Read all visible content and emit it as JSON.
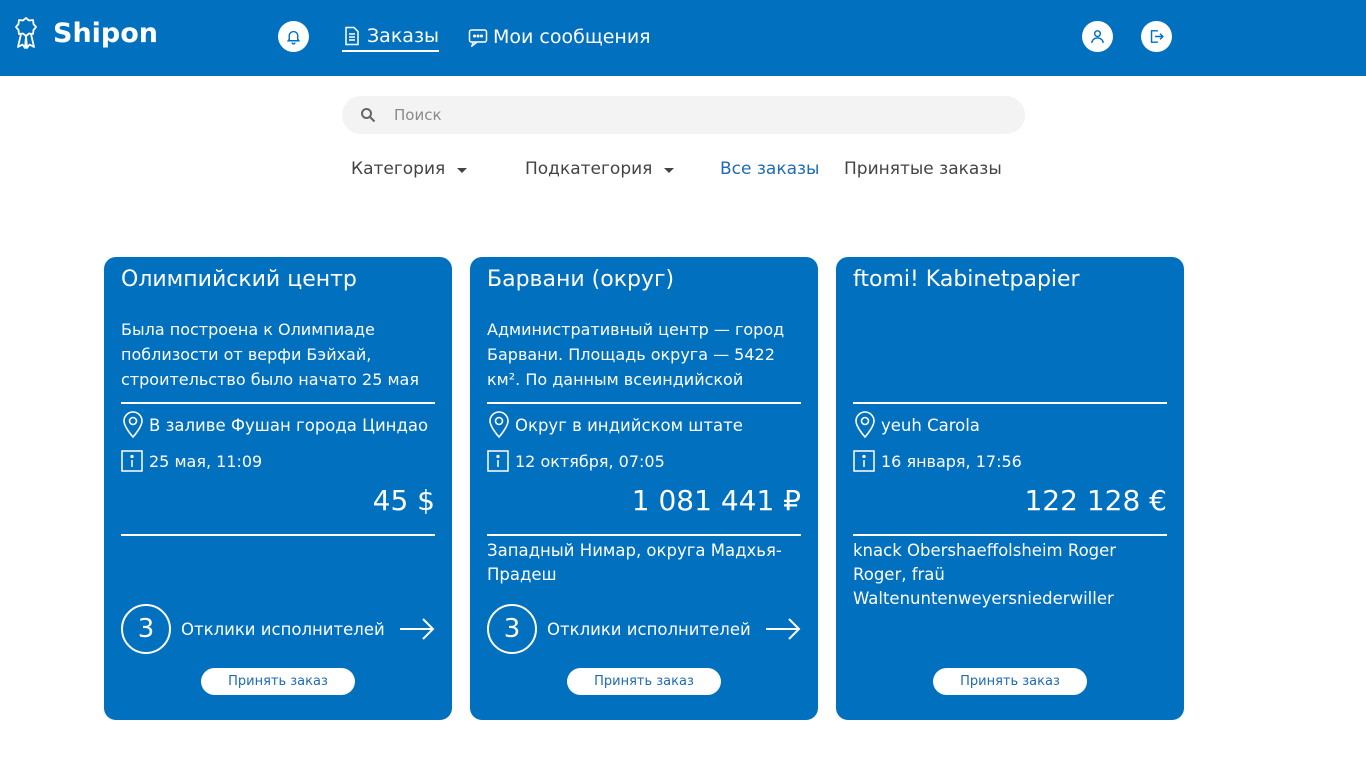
{
  "app": {
    "name": "Shipon",
    "logo_icon": "rosette-icon"
  },
  "nav": {
    "orders_label": "Заказы",
    "messages_label": "Мои сообщения"
  },
  "search": {
    "placeholder": "Поиск"
  },
  "filters": {
    "category_label": "Категория",
    "subcategory_label": "Подкатегория",
    "all_orders_label": "Все заказы",
    "accepted_orders_label": "Принятые заказы"
  },
  "colors": {
    "brand": "#0070bf",
    "link": "#1e6bb3"
  },
  "cards": [
    {
      "title": "Олимпийский центр",
      "description": "Была построена к Олимпиаде поблизости от верфи Бэйхай, строительство было начато 25 мая",
      "location": "В заливе Фушан города Циндао",
      "date": "25 мая, 11:09",
      "price": "45 $",
      "address": "",
      "responses_count": "3",
      "responses_label": "Отклики исполнителей",
      "accept_label": "Принять заказ"
    },
    {
      "title": "Барвани (округ)",
      "description": "Административный центр — город Барвани. Площадь округа — 5422 км². По данным всеиндийской",
      "location": "Округ в индийском штате",
      "date": "12 октября, 07:05",
      "price": "1 081 441 ₽",
      "address": "Западный Нимар, округа Мадхья-Прадеш",
      "responses_count": "3",
      "responses_label": "Отклики исполнителей",
      "accept_label": "Принять заказ"
    },
    {
      "title": "ftomi! Kabinetpapier",
      "description": "",
      "location": "yeuh Carola",
      "date": "16 января, 17:56",
      "price": "122 128 €",
      "address": "knack Obershaeffolsheim Roger Roger, fraü Waltenuntenweyersniederwiller",
      "accept_label": "Принять заказ"
    }
  ]
}
